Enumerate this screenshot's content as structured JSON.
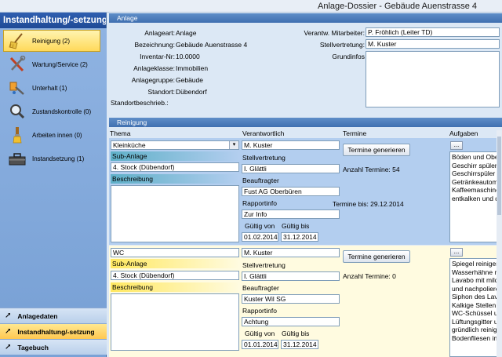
{
  "window": {
    "title": "Anlage-Dossier - Gebäude Auenstrasse 4"
  },
  "sidebar": {
    "header": "Instandhaltung/-setzung",
    "items": [
      {
        "label": "Reinigung (2)",
        "icon": "broom-icon"
      },
      {
        "label": "Wartung/Service (2)",
        "icon": "tools-icon"
      },
      {
        "label": "Unterhalt (1)",
        "icon": "wrench-icon"
      },
      {
        "label": "Zustandskontrolle (0)",
        "icon": "magnifier-icon"
      },
      {
        "label": "Arbeiten innen (0)",
        "icon": "paintbrush-icon"
      },
      {
        "label": "Instandsetzung (1)",
        "icon": "toolbox-icon"
      }
    ],
    "nav": [
      {
        "label": "Anlagedaten"
      },
      {
        "label": "Instandhaltung/-setzung"
      },
      {
        "label": "Tagebuch"
      }
    ]
  },
  "anlage": {
    "section_title": "Anlage",
    "labels": {
      "anlageart": "Anlageart:",
      "bezeichnung": "Bezeichnung:",
      "inventar": "Inventar-Nr:",
      "klasse": "Anlageklasse:",
      "gruppe": "Anlagegruppe:",
      "standort": "Standort:",
      "standortbeschrieb": "Standortbeschrieb.:",
      "mitarbeiter": "Verantw. Mitarbeiter:",
      "stellvertretung": "Stellvertretung:",
      "grundinfos": "Grundinfos"
    },
    "values": {
      "anlageart": "Anlage",
      "bezeichnung": "Gebäude Auenstrasse 4",
      "inventar": "10.0000",
      "klasse": "Immobilien",
      "gruppe": "Gebäude",
      "standort": "Dübendorf",
      "mitarbeiter": "P. Fröhlich (Leiter TD)",
      "stellvertretung": "M. Kuster"
    }
  },
  "reinigung": {
    "section_title": "Reinigung",
    "columns": [
      "Thema",
      "Verantwortlich",
      "Termine",
      "Aufgaben"
    ],
    "labels": {
      "sub_anlage": "Sub-Anlage",
      "beschreibung": "Beschreibung",
      "stellvertretung": "Stellvertretung",
      "beauftragter": "Beauftragter",
      "rapportinfo": "Rapportinfo",
      "gueltig_von": "Gültig von",
      "gueltig_bis": "Gültig bis",
      "generate_button": "Termine generieren",
      "dots": "..."
    },
    "rows": [
      {
        "thema": "Kleinküche",
        "sub_anlage": "4. Stock (Dübendorf)",
        "verantwortlich": "M. Kuster",
        "stellvertretung": "I. Glättli",
        "beauftragter": "Fust AG Oberbüren",
        "rapportinfo": "Zur Info",
        "von": "01.02.2014",
        "bis": "31.12.2014",
        "anzahl": "Anzahl Termine: 54",
        "termine_bis": "Termine bis: 29.12.2014",
        "aufgaben": [
          "Böden und Ober",
          "Geschirr spülen",
          "Geschirrspüler r",
          "Getränkeautoma",
          "Kaffeemaschine",
          "entkalken und d"
        ]
      },
      {
        "thema": "WC",
        "sub_anlage": "4. Stock (Dübendorf)",
        "verantwortlich": "M. Kuster",
        "stellvertretung": "I. Glättli",
        "beauftragter": "Kuster  Wil SG",
        "rapportinfo": "Achtung",
        "von": "01.01.2014",
        "bis": "31.12.2014",
        "anzahl": "Anzahl Termine: 0",
        "termine_bis": "",
        "aufgaben": [
          "Spiegel reinigen",
          "Wasserhähne re",
          "Lavabo mit milde",
          "und nachpoliere",
          "Siphon des Lava",
          "Kalkige Stellen",
          "WC-Schüssel ur",
          "Lüftungsgitter u",
          "gründlich reinige",
          "Bodenfliesen in"
        ]
      }
    ]
  },
  "colors": {
    "sidebar_header": "#1f4a96",
    "active_item": "#ffd95a",
    "section_header": "#3f6fb0",
    "row_blue": "#b3ceef",
    "row_yellow": "#fffbe0"
  }
}
